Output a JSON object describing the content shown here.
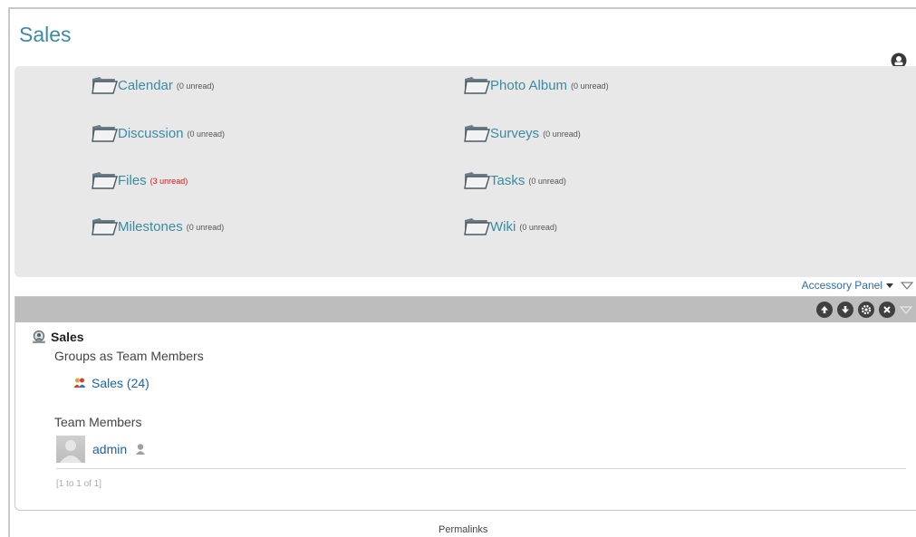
{
  "page": {
    "title": "Sales"
  },
  "folders": [
    {
      "name": "Calendar",
      "unread": "(0 unread)",
      "hot": false
    },
    {
      "name": "Photo Album",
      "unread": "(0 unread)",
      "hot": false
    },
    {
      "name": "Discussion",
      "unread": "(0 unread)",
      "hot": false
    },
    {
      "name": "Surveys",
      "unread": "(0 unread)",
      "hot": false
    },
    {
      "name": "Files",
      "unread": "(3 unread)",
      "hot": true
    },
    {
      "name": "Tasks",
      "unread": "(0 unread)",
      "hot": false
    },
    {
      "name": "Milestones",
      "unread": "(0 unread)",
      "hot": false
    },
    {
      "name": "Wiki",
      "unread": "(0 unread)",
      "hot": false
    }
  ],
  "accessory": {
    "label": "Accessory Panel"
  },
  "portlet": {
    "team_name": "Sales",
    "groups_label": "Groups as Team Members",
    "group_link": "Sales (24)",
    "members_label": "Team Members",
    "members": [
      {
        "name": "admin"
      }
    ],
    "pager": "[1 to 1 of 1]"
  },
  "footer": {
    "permalinks": "Permalinks"
  },
  "colors": {
    "link": "#1a63a6",
    "folder_text": "#3a8ba3",
    "title": "#3d8aa1",
    "unread_hot": "#e21414",
    "panel_bg": "#e8e8e8",
    "header_bg": "#bdbdbd"
  },
  "icons": [
    "user-circle-icon",
    "folder-icon",
    "arrow-up-icon",
    "arrow-down-icon",
    "gear-icon",
    "close-icon",
    "collapse-triangle-icon",
    "team-icon",
    "group-icon",
    "user-silhouette-icon"
  ]
}
